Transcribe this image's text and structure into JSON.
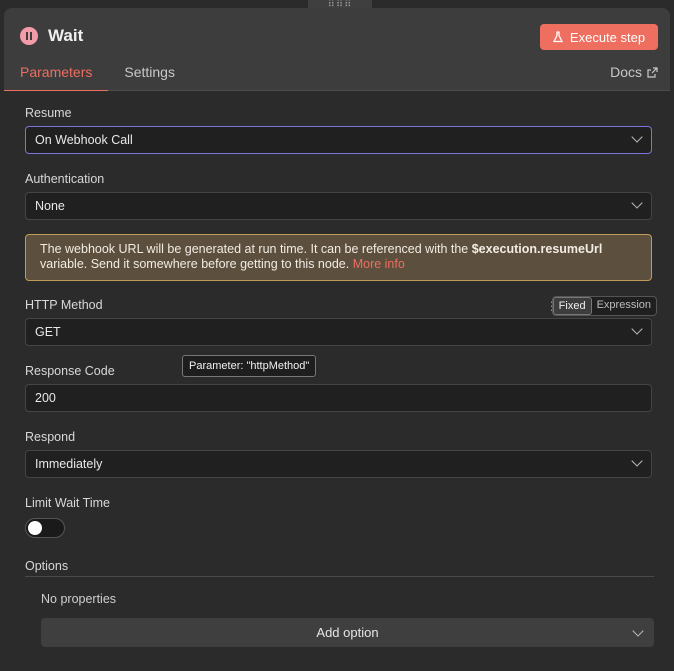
{
  "drag_handle": "⠿⠿⠿",
  "node": {
    "title": "Wait",
    "execute_label": "Execute step"
  },
  "tabs": [
    {
      "label": "Parameters",
      "active": true
    },
    {
      "label": "Settings",
      "active": false
    }
  ],
  "docs_label": "Docs",
  "fields": {
    "resume": {
      "label": "Resume",
      "value": "On Webhook Call"
    },
    "authentication": {
      "label": "Authentication",
      "value": "None"
    },
    "http_method": {
      "label": "HTTP Method",
      "value": "GET"
    },
    "response_code": {
      "label": "Response Code",
      "value": "200"
    },
    "respond": {
      "label": "Respond",
      "value": "Immediately"
    },
    "limit_wait_time": {
      "label": "Limit Wait Time",
      "enabled": false
    }
  },
  "notice": {
    "text_before": "The webhook URL will be generated at run time. It can be referenced with the ",
    "code": "$execution.resumeUrl",
    "text_after": " variable. Send it somewhere before getting to this node. ",
    "link": "More info"
  },
  "mode_toggle": {
    "fixed": "Fixed",
    "expression": "Expression"
  },
  "tooltip": "Parameter: \"httpMethod\"",
  "options": {
    "label": "Options",
    "empty_text": "No properties",
    "add_label": "Add option"
  },
  "colors": {
    "accent": "#ee6e60",
    "focus": "#7b74d9",
    "icon_pink": "#f49ba8"
  }
}
